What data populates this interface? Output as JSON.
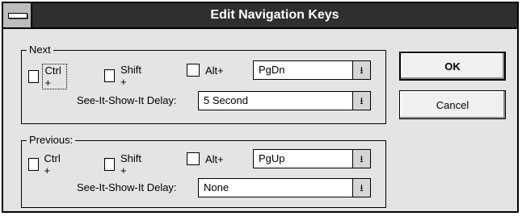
{
  "window": {
    "title": "Edit Navigation Keys"
  },
  "icons": {
    "system_menu": "system-menu-icon",
    "dropdown": "down-arrow-icon"
  },
  "glyphs": {
    "dropdown_arrow": "⭳"
  },
  "next": {
    "label": "Next",
    "ctrl_label": "Ctrl +",
    "shift_label": "Shift +",
    "alt_label": "Alt+",
    "key_value": "PgDn",
    "delay_label": "See-It-Show-It Delay:",
    "delay_value": "5 Second"
  },
  "previous": {
    "label": "Previous:",
    "ctrl_label": "Ctrl +",
    "shift_label": "Shift +",
    "alt_label": "Alt+",
    "key_value": "PgUp",
    "delay_label": "See-It-Show-It Delay:",
    "delay_value": "None"
  },
  "buttons": {
    "ok": "OK",
    "cancel": "Cancel"
  }
}
